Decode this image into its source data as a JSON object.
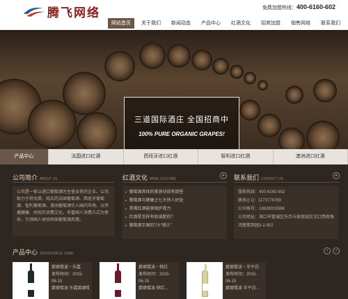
{
  "brand": {
    "name": "腾飞网络"
  },
  "hotline": {
    "label": "免费加盟热线：",
    "number": "400-6160-602"
  },
  "nav": {
    "items": [
      "网站首页",
      "关于我们",
      "新闻动态",
      "产品中心",
      "红酒文化",
      "招商加盟",
      "销售网络",
      "联系我们"
    ],
    "active": 0
  },
  "banner": {
    "title": "三道国际酒庄  全国招商中",
    "subtitle": "100% PURE ORGANIC GRAPES!"
  },
  "category_tabs": {
    "items": [
      "产品中心",
      "法国进口红酒",
      "西班牙进口红酒",
      "智利进口红酒",
      "澳洲进口红酒"
    ],
    "active": 0
  },
  "about": {
    "title": "公司简介",
    "title_en": "ABOUT US",
    "highlight": "公司",
    "text": "是一家以进口葡萄酒为主营业务的企业。公司致力于将优质、纯正的法国葡萄酒、西班牙葡萄酒、智利葡萄酒、澳洲葡萄酒引入国内市场，以传播健康、时尚的消费文化，丰富国人消费方式为使命，引领国人体验异国葡萄酒风情。"
  },
  "culture": {
    "title": "红酒文化",
    "title_en": "WINE CULTURE",
    "items": [
      "葡萄酒具体的美容功效有那些",
      "葡萄酒与健康之七大惊人好处",
      "常喝红酒能够保护视力",
      "红酒是怎样有助减肥的？",
      "葡萄酒王国的7大“骑士”"
    ]
  },
  "contact": {
    "title": "联系我们",
    "title_en": "CONTACT US",
    "lines": [
      "服务热线：400-6160-602",
      "联系Q Q：1173776769",
      "公众帐号：18639015598",
      "公司地址：海口市管城区东月与家居园交叉口西南角 鸿基紫荆园3-2-902"
    ]
  },
  "products": {
    "title": "产品中心",
    "title_en": "SUCCESSFUL CASE",
    "prev": "‹",
    "next": "›",
    "items": [
      {
        "name": "爵娜楼波・乐嘉",
        "date": "发布时间：2015-06-15",
        "desc": "爵娜楼波 乐嘉爵娜楼波・乐嘉",
        "bottle_color": "#1d2b26"
      },
      {
        "name": "爵娜楼波・桃红",
        "date": "发布时间：2015-06-15",
        "desc": "爵娜楼波 桃红...",
        "bottle_color": "#6a1a2a"
      },
      {
        "name": "爵娜楼波・半干白",
        "date": "发布时间：2015-06-15",
        "desc": "爵娜楼波 半干白...",
        "bottle_color": "#d9cfa4"
      }
    ]
  },
  "colors": {
    "accent": "#6b5748",
    "bg": "#2e2620",
    "panel": "#3a302a",
    "highlight": "#e8a34c"
  }
}
